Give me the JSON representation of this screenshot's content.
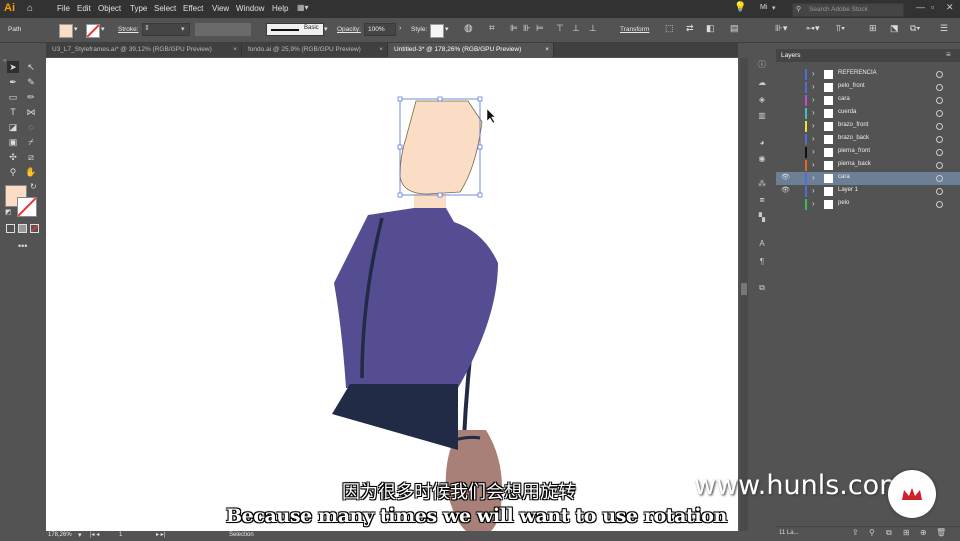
{
  "app": {
    "logo": "Ai"
  },
  "menu": [
    "File",
    "Edit",
    "Object",
    "Type",
    "Select",
    "Effect",
    "View",
    "Window",
    "Help"
  ],
  "topright": {
    "workspace": "Mi",
    "search_placeholder": "Search Adobe Stock"
  },
  "control": {
    "path_label": "Path",
    "stroke_label": "Stroke:",
    "stroke_style": "Basic",
    "opacity_label": "Opacity:",
    "opacity_value": "100%",
    "style_label": "Style:",
    "transform_label": "Transform",
    "fill_color": "#fbdcc4"
  },
  "tabs": [
    {
      "label": "U3_L7_Styleframes.ai* @ 39,12% (RGB/GPU Preview)",
      "active": false
    },
    {
      "label": "fondo.ai @ 25,9% (RGB/GPU Preview)",
      "active": false
    },
    {
      "label": "Untitled-3* @ 178,26% (RGB/GPU Preview)",
      "active": true
    }
  ],
  "status": {
    "zoom": "178,26%",
    "artboard": "1",
    "tool": "Selection"
  },
  "layers_panel": {
    "title": "Layers",
    "count_label": "11 La...",
    "rows": [
      {
        "name": "REFERENCIA",
        "color": "#4f6fd6",
        "eye": false,
        "selected": false
      },
      {
        "name": "pelo_front",
        "color": "#4f6fd6",
        "eye": false,
        "selected": false
      },
      {
        "name": "cara",
        "color": "#c04bd6",
        "eye": false,
        "selected": false
      },
      {
        "name": "cuerda",
        "color": "#40c0c0",
        "eye": false,
        "selected": false
      },
      {
        "name": "brazo_front",
        "color": "#e8e23a",
        "eye": false,
        "selected": false
      },
      {
        "name": "brazo_back",
        "color": "#4f6fd6",
        "eye": false,
        "selected": false
      },
      {
        "name": "pierna_front",
        "color": "#111111",
        "eye": false,
        "selected": false
      },
      {
        "name": "pierna_back",
        "color": "#e06a20",
        "eye": false,
        "selected": false
      },
      {
        "name": "cara",
        "color": "#4f6fd6",
        "eye": true,
        "selected": true
      },
      {
        "name": "Layer 1",
        "color": "#4f6fd6",
        "eye": true,
        "selected": false
      },
      {
        "name": "pelo",
        "color": "#3ac04f",
        "eye": false,
        "selected": false
      }
    ]
  },
  "subtitles": {
    "zh": "因为很多时候我们会想用旋转",
    "en": "Because many times we will want to use rotation"
  },
  "watermark": "www.hunls.com"
}
